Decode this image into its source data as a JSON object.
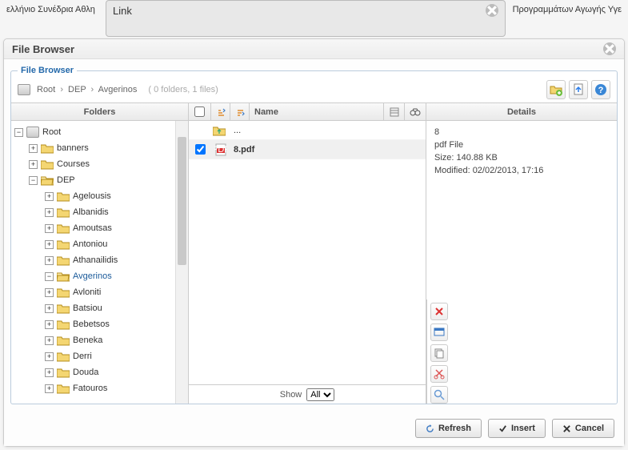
{
  "bgText": {
    "left": "ελλήνιο Συνέδρια Αθλη",
    "right": "Προγραμμάτων Αγωγής Υγε"
  },
  "linkDialog": {
    "title": "Link"
  },
  "browser": {
    "title": "File Browser",
    "legend": "File Browser",
    "path": {
      "root": "Root",
      "p1": "DEP",
      "p2": "Avgerinos",
      "sep": "›",
      "info": "( 0 folders, 1 files)"
    },
    "columns": {
      "folders": "Folders",
      "name": "Name",
      "details": "Details"
    },
    "tree": {
      "root": "Root",
      "banners": "banners",
      "courses": "Courses",
      "dep": "DEP",
      "items": [
        "Agelousis",
        "Albanidis",
        "Amoutsas",
        "Antoniou",
        "Athanailidis",
        "Avgerinos",
        "Avloniti",
        "Batsiou",
        "Bebetsos",
        "Beneka",
        "Derri",
        "Douda",
        "Fatouros"
      ]
    },
    "files": {
      "up": "...",
      "f1": "8.pdf"
    },
    "details": {
      "name": "8",
      "type": "pdf File",
      "size": "Size: 140.88 KB",
      "modified": "Modified: 02/02/2013, 17:16"
    },
    "showbar": {
      "label": "Show",
      "all": "All"
    },
    "footer": {
      "refresh": "Refresh",
      "insert": "Insert",
      "cancel": "Cancel"
    }
  }
}
